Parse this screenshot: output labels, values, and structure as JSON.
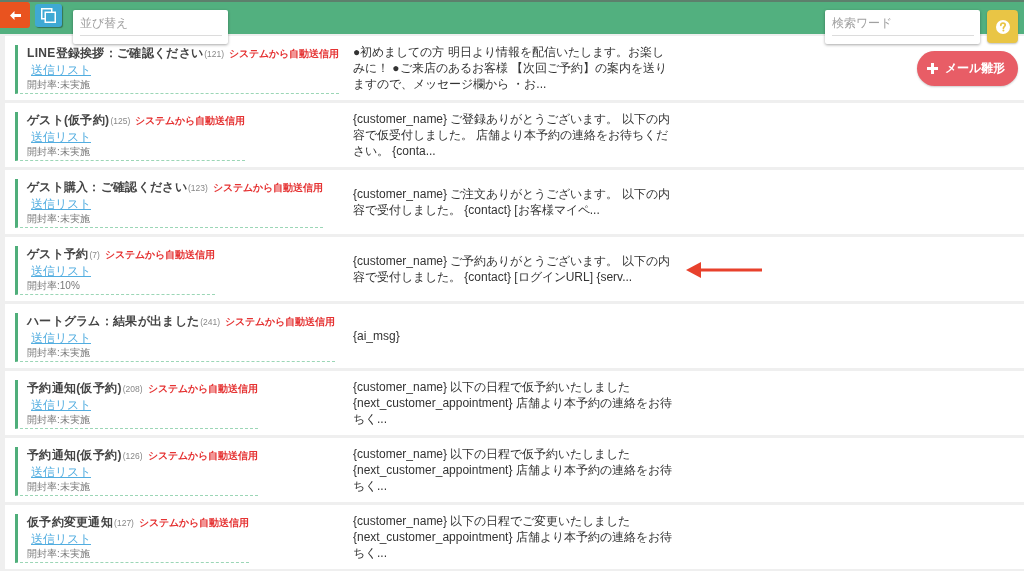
{
  "toolbar": {
    "sort_field": {
      "placeholder": "並び替え"
    },
    "search_field": {
      "placeholder": "検索ワード"
    }
  },
  "add_button": {
    "label": "メール雛形"
  },
  "templates": [
    {
      "title": "LINE登録挨拶：ご確認ください",
      "count": "(121)",
      "tag": "システムから自動送信用",
      "link": "送信リスト",
      "open_rate": "開封率:未実施",
      "preview": "●初めましての方 明日より情報を配信いたします。お楽しみに！ ●ご来店のあるお客様 【次回ご予約】の案内を送りますので、メッセージ欄から ・お..."
    },
    {
      "title": "ゲスト(仮予約)",
      "count": "(125)",
      "tag": "システムから自動送信用",
      "link": "送信リスト",
      "open_rate": "開封率:未実施",
      "preview": "{customer_name} ご登録ありがとうございます。 以下の内容で仮受付しました。 店舗より本予約の連絡をお待ちください。 {conta..."
    },
    {
      "title": "ゲスト購入：ご確認ください",
      "count": "(123)",
      "tag": "システムから自動送信用",
      "link": "送信リスト",
      "open_rate": "開封率:未実施",
      "preview": "{customer_name} ご注文ありがとうございます。 以下の内容で受付しました。 {contact} [お客様マイペ..."
    },
    {
      "title": "ゲスト予約",
      "count": "(7)",
      "tag": "システムから自動送信用",
      "link": "送信リスト",
      "open_rate": "開封率:10%",
      "preview": "{customer_name} ご予約ありがとうございます。 以下の内容で受付しました。 {contact} [ログインURL] {serv..."
    },
    {
      "title": "ハートグラム：結果が出ました",
      "count": "(241)",
      "tag": "システムから自動送信用",
      "link": "送信リスト",
      "open_rate": "開封率:未実施",
      "preview": "{ai_msg}"
    },
    {
      "title": "予約通知(仮予約)",
      "count": "(208)",
      "tag": "システムから自動送信用",
      "link": "送信リスト",
      "open_rate": "開封率:未実施",
      "preview": "{customer_name} 以下の日程で仮予約いたしました {next_customer_appointment} 店舗より本予約の連絡をお待ちく..."
    },
    {
      "title": "予約通知(仮予約)",
      "count": "(126)",
      "tag": "システムから自動送信用",
      "link": "送信リスト",
      "open_rate": "開封率:未実施",
      "preview": "{customer_name} 以下の日程で仮予約いたしました {next_customer_appointment} 店舗より本予約の連絡をお待ちく..."
    },
    {
      "title": "仮予約変更通知",
      "count": "(127)",
      "tag": "システムから自動送信用",
      "link": "送信リスト",
      "open_rate": "開封率:未実施",
      "preview": "{customer_name} 以下の日程でご変更いたしました {next_customer_appointment} 店舗より本予約の連絡をお待ちく..."
    }
  ]
}
